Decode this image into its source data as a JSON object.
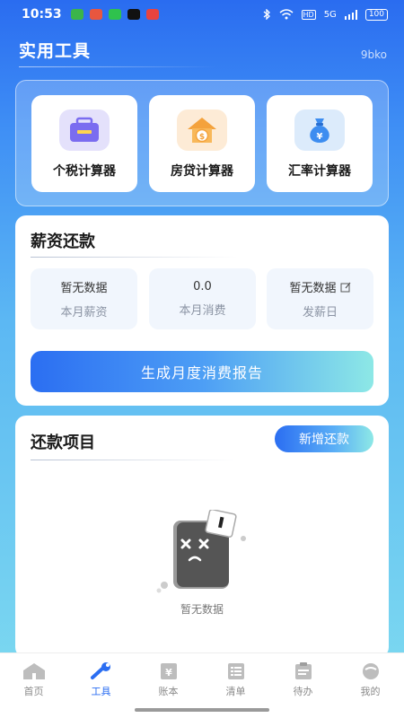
{
  "status_bar": {
    "time": "10:53",
    "network": "HD",
    "signal": "5G",
    "battery": "100"
  },
  "header": {
    "title": "实用工具",
    "tag": "9bko"
  },
  "tools": [
    {
      "label": "个税计算器",
      "icon": "briefcase-icon",
      "bg": "#e4e1fb",
      "color": "#7a6cf0"
    },
    {
      "label": "房贷计算器",
      "icon": "house-coin-icon",
      "bg": "#fdebd6",
      "color": "#f4a23c"
    },
    {
      "label": "汇率计算器",
      "icon": "money-bag-icon",
      "bg": "#dcebfb",
      "color": "#3d8df0"
    }
  ],
  "salary": {
    "title": "薪资还款",
    "stats": [
      {
        "value": "暂无数据",
        "label": "本月薪资"
      },
      {
        "value": "0.0",
        "label": "本月消费"
      },
      {
        "value": "暂无数据",
        "label": "发薪日"
      }
    ],
    "report_button": "生成月度消费报告"
  },
  "repay": {
    "title": "还款项目",
    "add_button": "新增还款",
    "empty_text": "暂无数据"
  },
  "tabs": [
    {
      "label": "首页",
      "icon": "home-icon",
      "active": false
    },
    {
      "label": "工具",
      "icon": "wrench-icon",
      "active": true
    },
    {
      "label": "账本",
      "icon": "ledger-icon",
      "active": false
    },
    {
      "label": "清单",
      "icon": "list-icon",
      "active": false
    },
    {
      "label": "待办",
      "icon": "clipboard-icon",
      "active": false
    },
    {
      "label": "我的",
      "icon": "profile-icon",
      "active": false
    }
  ],
  "colors": {
    "accent": "#2b6ef2",
    "gradient_end": "#8de8e6"
  }
}
